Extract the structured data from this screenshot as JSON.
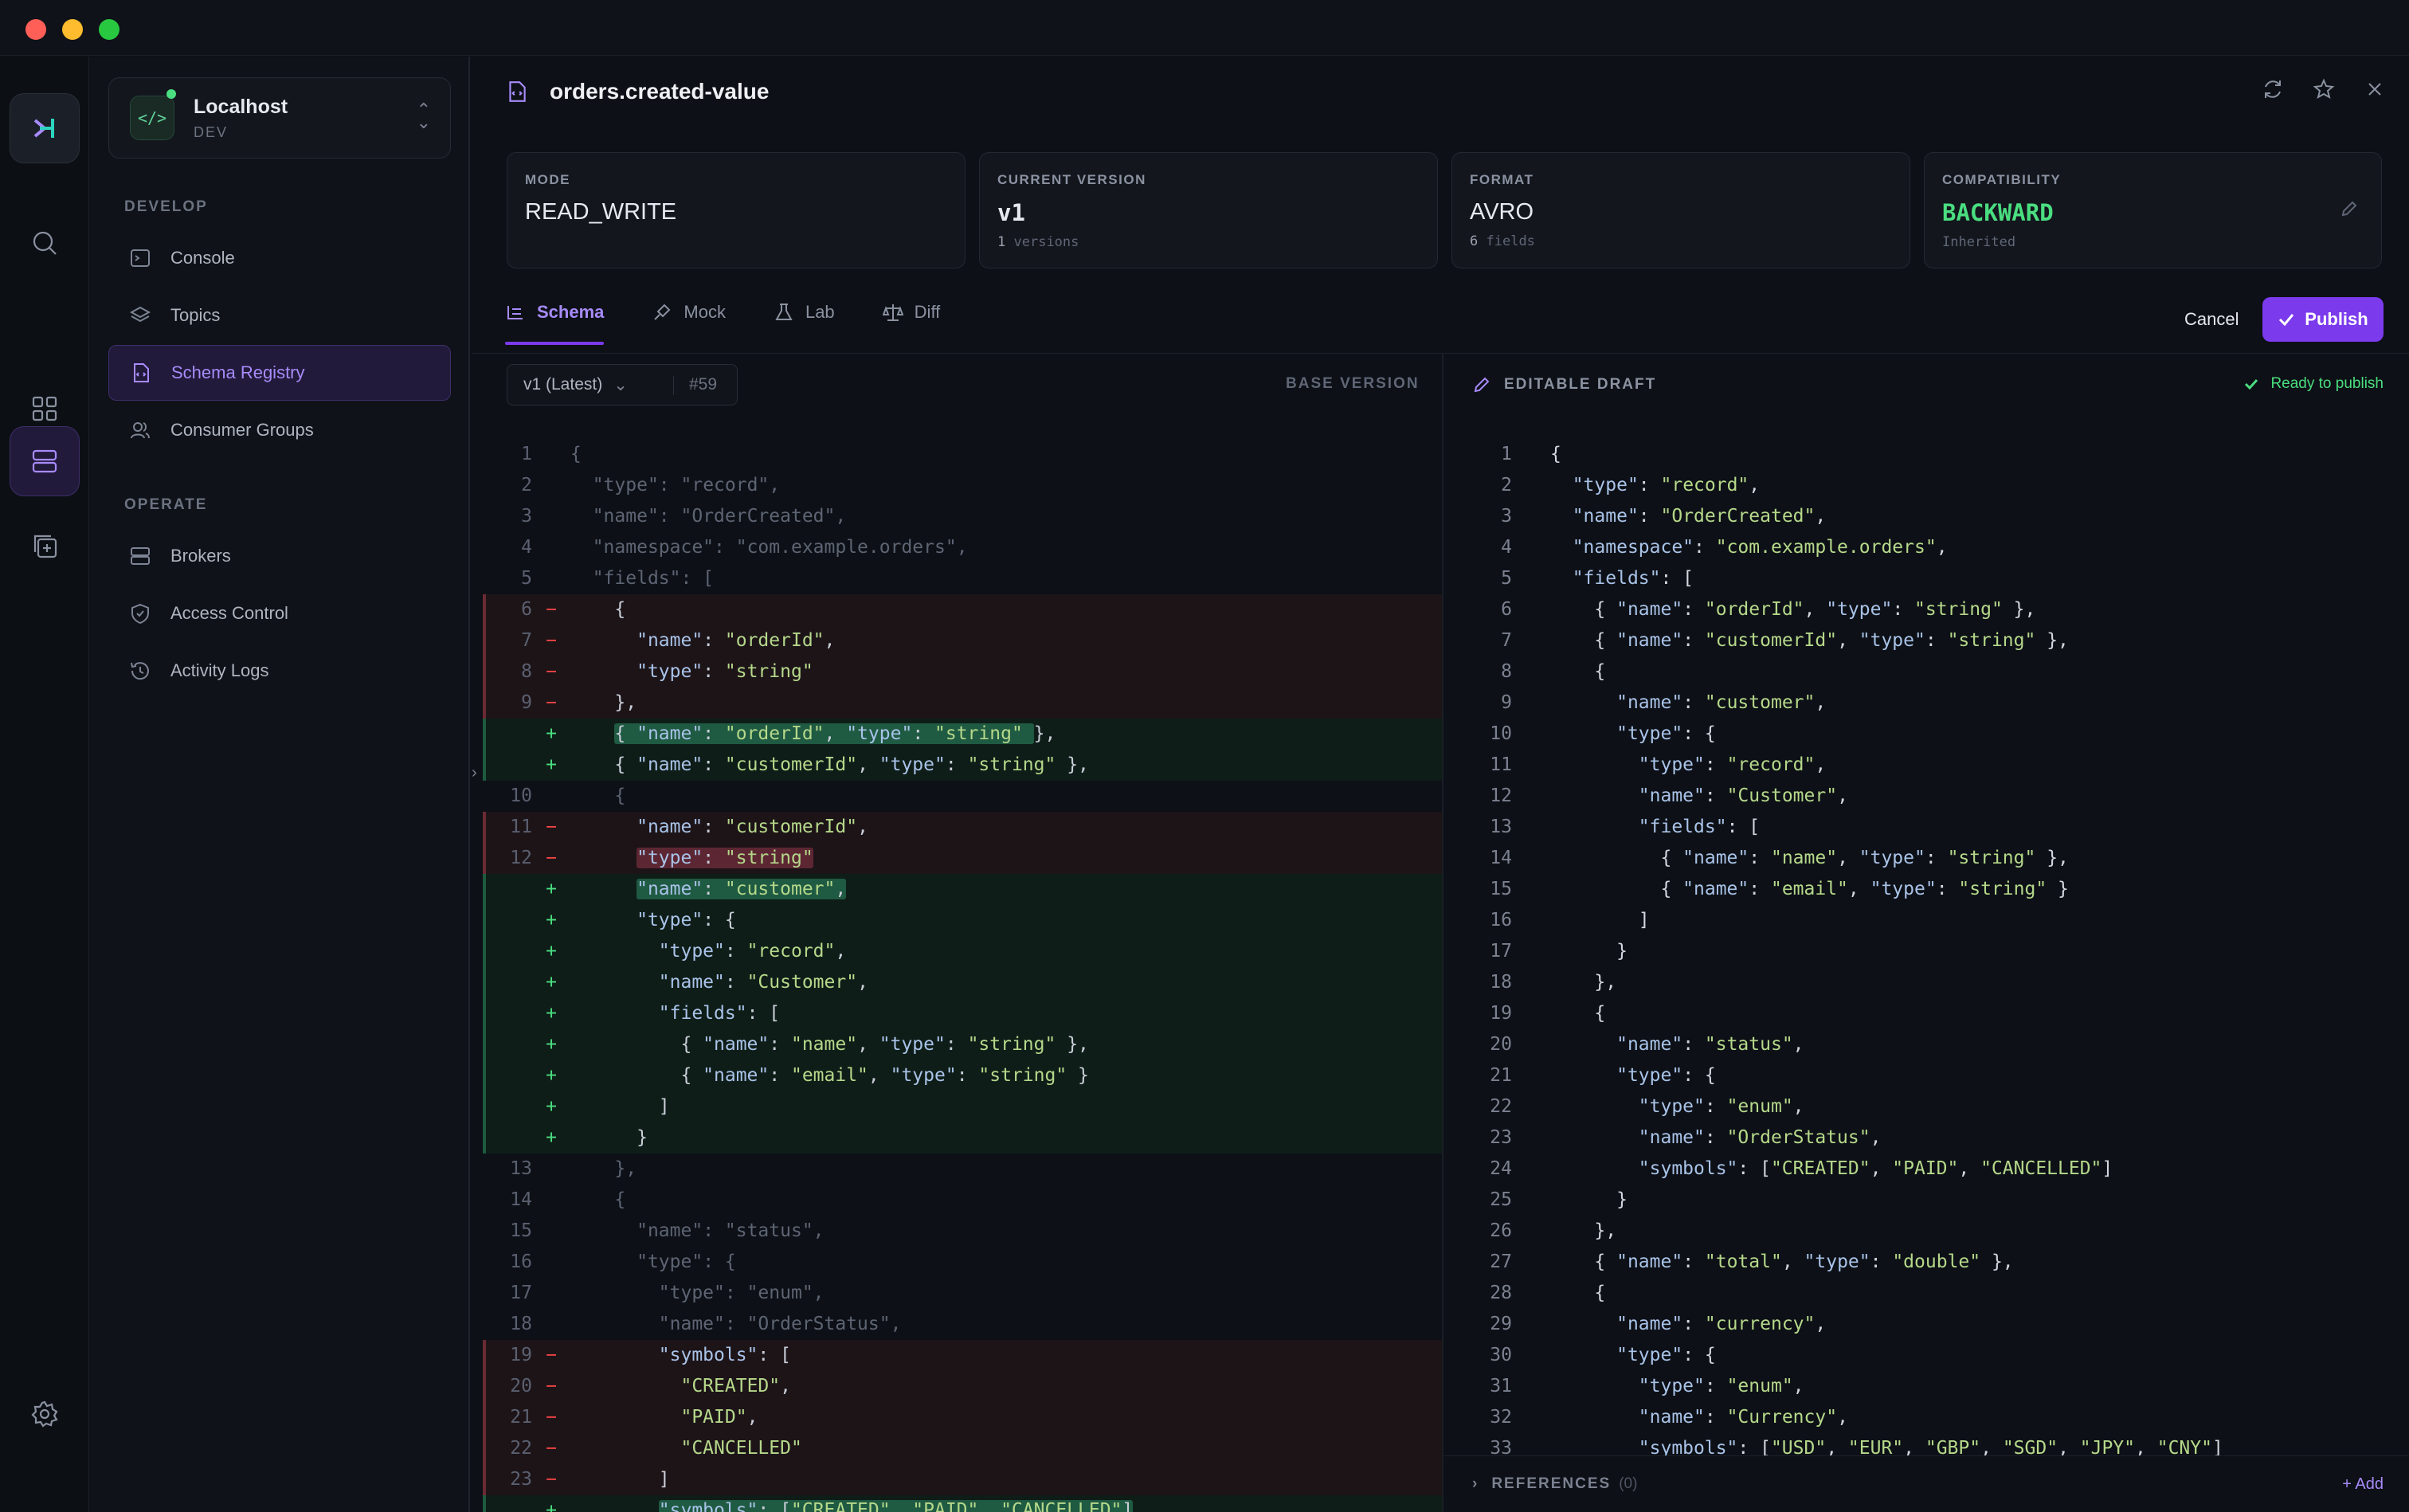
{
  "window": {
    "title": "orders.created-value"
  },
  "env": {
    "name": "Localhost",
    "tag": "DEV"
  },
  "sidebar": {
    "develop_label": "DEVELOP",
    "operate_label": "OPERATE",
    "develop": [
      {
        "label": "Console",
        "icon": "terminal-icon"
      },
      {
        "label": "Topics",
        "icon": "layers-icon"
      },
      {
        "label": "Schema Registry",
        "icon": "schema-file-icon",
        "active": true
      },
      {
        "label": "Consumer Groups",
        "icon": "users-icon"
      }
    ],
    "operate": [
      {
        "label": "Brokers",
        "icon": "server-icon"
      },
      {
        "label": "Access Control",
        "icon": "shield-icon"
      },
      {
        "label": "Activity Logs",
        "icon": "history-icon"
      }
    ]
  },
  "cards": {
    "mode": {
      "label": "MODE",
      "value": "READ_WRITE"
    },
    "version": {
      "label": "CURRENT VERSION",
      "value": "v1",
      "sub_num": "1",
      "sub_text": "versions"
    },
    "format": {
      "label": "FORMAT",
      "value": "AVRO",
      "sub_num": "6",
      "sub_text": "fields"
    },
    "compat": {
      "label": "COMPATIBILITY",
      "value": "BACKWARD",
      "sub_text": "Inherited",
      "accent": "#4ade80"
    }
  },
  "tabs": [
    {
      "label": "Schema",
      "active": true
    },
    {
      "label": "Mock"
    },
    {
      "label": "Lab"
    },
    {
      "label": "Diff"
    }
  ],
  "actions": {
    "cancel": "Cancel",
    "publish": "Publish"
  },
  "diff": {
    "version_select": "v1 (Latest)",
    "version_id": "#59",
    "base_label": "BASE VERSION",
    "draft_label": "EDITABLE DRAFT",
    "ready_label": "Ready to publish",
    "left": [
      {
        "n": "1",
        "m": "",
        "t": "ctx",
        "c": "{"
      },
      {
        "n": "2",
        "m": "",
        "t": "ctx",
        "c": "  \"type\": \"record\","
      },
      {
        "n": "3",
        "m": "",
        "t": "ctx",
        "c": "  \"name\": \"OrderCreated\","
      },
      {
        "n": "4",
        "m": "",
        "t": "ctx",
        "c": "  \"namespace\": \"com.example.orders\","
      },
      {
        "n": "5",
        "m": "",
        "t": "ctx",
        "c": "  \"fields\": ["
      },
      {
        "n": "6",
        "m": "−",
        "t": "del",
        "c": "    {"
      },
      {
        "n": "7",
        "m": "−",
        "t": "del",
        "c": "      \"name\": \"orderId\","
      },
      {
        "n": "8",
        "m": "−",
        "t": "del",
        "c": "      \"type\": \"string\""
      },
      {
        "n": "9",
        "m": "−",
        "t": "del",
        "c": "    },"
      },
      {
        "n": "",
        "m": "+",
        "t": "add",
        "c": "    { \"name\": \"orderId\", \"type\": \"string\" },",
        "hl": "{ \"name\": \"orderId\", \"type\": \"string\" "
      },
      {
        "n": "",
        "m": "+",
        "t": "add",
        "c": "    { \"name\": \"customerId\", \"type\": \"string\" },"
      },
      {
        "n": "10",
        "m": "",
        "t": "ctx",
        "c": "    {"
      },
      {
        "n": "11",
        "m": "−",
        "t": "del",
        "c": "      \"name\": \"customerId\","
      },
      {
        "n": "12",
        "m": "−",
        "t": "del",
        "c": "      \"type\": \"string\"",
        "hl": "\"type\": \"string\""
      },
      {
        "n": "",
        "m": "+",
        "t": "add",
        "c": "      \"name\": \"customer\",",
        "hl": "\"name\": \"customer\","
      },
      {
        "n": "",
        "m": "+",
        "t": "add",
        "c": "      \"type\": {"
      },
      {
        "n": "",
        "m": "+",
        "t": "add",
        "c": "        \"type\": \"record\","
      },
      {
        "n": "",
        "m": "+",
        "t": "add",
        "c": "        \"name\": \"Customer\","
      },
      {
        "n": "",
        "m": "+",
        "t": "add",
        "c": "        \"fields\": ["
      },
      {
        "n": "",
        "m": "+",
        "t": "add",
        "c": "          { \"name\": \"name\", \"type\": \"string\" },"
      },
      {
        "n": "",
        "m": "+",
        "t": "add",
        "c": "          { \"name\": \"email\", \"type\": \"string\" }"
      },
      {
        "n": "",
        "m": "+",
        "t": "add",
        "c": "        ]"
      },
      {
        "n": "",
        "m": "+",
        "t": "add",
        "c": "      }"
      },
      {
        "n": "13",
        "m": "",
        "t": "ctx",
        "c": "    },"
      },
      {
        "n": "14",
        "m": "",
        "t": "ctx",
        "c": "    {"
      },
      {
        "n": "15",
        "m": "",
        "t": "ctx",
        "c": "      \"name\": \"status\","
      },
      {
        "n": "16",
        "m": "",
        "t": "ctx",
        "c": "      \"type\": {"
      },
      {
        "n": "17",
        "m": "",
        "t": "ctx",
        "c": "        \"type\": \"enum\","
      },
      {
        "n": "18",
        "m": "",
        "t": "ctx",
        "c": "        \"name\": \"OrderStatus\","
      },
      {
        "n": "19",
        "m": "−",
        "t": "del",
        "c": "        \"symbols\": ["
      },
      {
        "n": "20",
        "m": "−",
        "t": "del",
        "c": "          \"CREATED\","
      },
      {
        "n": "21",
        "m": "−",
        "t": "del",
        "c": "          \"PAID\","
      },
      {
        "n": "22",
        "m": "−",
        "t": "del",
        "c": "          \"CANCELLED\""
      },
      {
        "n": "23",
        "m": "−",
        "t": "del",
        "c": "        ]"
      },
      {
        "n": "",
        "m": "+",
        "t": "add",
        "c": "        \"symbols\": [\"CREATED\", \"PAID\", \"CANCELLED\"]",
        "hl": "\"symbols\": [\"CREATED\", \"PAID\", \"CANCELLED\"]"
      }
    ],
    "right": [
      {
        "n": "1",
        "c": "{"
      },
      {
        "n": "2",
        "c": "  \"type\": \"record\","
      },
      {
        "n": "3",
        "c": "  \"name\": \"OrderCreated\","
      },
      {
        "n": "4",
        "c": "  \"namespace\": \"com.example.orders\","
      },
      {
        "n": "5",
        "c": "  \"fields\": ["
      },
      {
        "n": "6",
        "c": "    { \"name\": \"orderId\", \"type\": \"string\" },"
      },
      {
        "n": "7",
        "c": "    { \"name\": \"customerId\", \"type\": \"string\" },"
      },
      {
        "n": "8",
        "c": "    {"
      },
      {
        "n": "9",
        "c": "      \"name\": \"customer\","
      },
      {
        "n": "10",
        "c": "      \"type\": {"
      },
      {
        "n": "11",
        "c": "        \"type\": \"record\","
      },
      {
        "n": "12",
        "c": "        \"name\": \"Customer\","
      },
      {
        "n": "13",
        "c": "        \"fields\": ["
      },
      {
        "n": "14",
        "c": "          { \"name\": \"name\", \"type\": \"string\" },"
      },
      {
        "n": "15",
        "c": "          { \"name\": \"email\", \"type\": \"string\" }"
      },
      {
        "n": "16",
        "c": "        ]"
      },
      {
        "n": "17",
        "c": "      }"
      },
      {
        "n": "18",
        "c": "    },"
      },
      {
        "n": "19",
        "c": "    {"
      },
      {
        "n": "20",
        "c": "      \"name\": \"status\","
      },
      {
        "n": "21",
        "c": "      \"type\": {"
      },
      {
        "n": "22",
        "c": "        \"type\": \"enum\","
      },
      {
        "n": "23",
        "c": "        \"name\": \"OrderStatus\","
      },
      {
        "n": "24",
        "c": "        \"symbols\": [\"CREATED\", \"PAID\", \"CANCELLED\"]"
      },
      {
        "n": "25",
        "c": "      }"
      },
      {
        "n": "26",
        "c": "    },"
      },
      {
        "n": "27",
        "c": "    { \"name\": \"total\", \"type\": \"double\" },"
      },
      {
        "n": "28",
        "c": "    {"
      },
      {
        "n": "29",
        "c": "      \"name\": \"currency\","
      },
      {
        "n": "30",
        "c": "      \"type\": {"
      },
      {
        "n": "31",
        "c": "        \"type\": \"enum\","
      },
      {
        "n": "32",
        "c": "        \"name\": \"Currency\","
      },
      {
        "n": "33",
        "c": "        \"symbols\": [\"USD\", \"EUR\", \"GBP\", \"SGD\", \"JPY\", \"CNY\"]"
      }
    ],
    "references": {
      "label": "REFERENCES",
      "count": "(0)",
      "add": "+ Add"
    }
  }
}
